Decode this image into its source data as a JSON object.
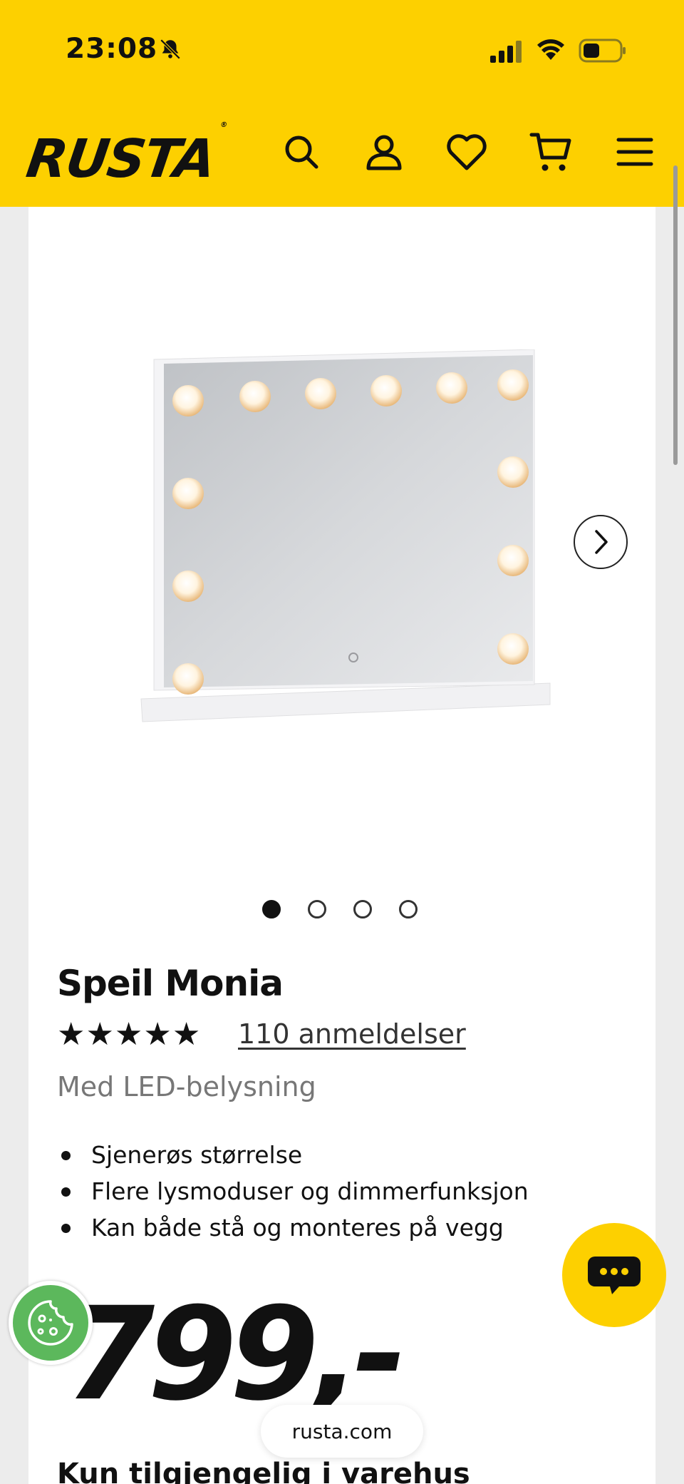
{
  "status_bar": {
    "time": "23:08",
    "icons": [
      "bell-slash-icon",
      "signal-icon",
      "wifi-icon",
      "battery-icon"
    ]
  },
  "header": {
    "logo": "RUSTA",
    "logo_mark": "®",
    "icons": [
      "search-icon",
      "user-icon",
      "heart-icon",
      "cart-icon",
      "menu-icon"
    ],
    "brand_color": "#fdd000"
  },
  "gallery": {
    "image_count": 4,
    "active_index": 0,
    "next_icon": "chevron-right-icon"
  },
  "product": {
    "title": "Speil Monia",
    "rating_stars": 5,
    "reviews": "110 anmeldelser",
    "subtitle": "Med LED-belysning",
    "features": [
      "Sjenerøs størrelse",
      "Flere lysmoduser og dimmerfunksjon",
      "Kan både stå og monteres på vegg"
    ],
    "price": "799,-",
    "availability": "Kun tilgjengelig i varehus"
  },
  "floating": {
    "chat_icon": "chat-bubble-icon",
    "cookie_icon": "cookie-icon",
    "url": "rusta.com"
  }
}
